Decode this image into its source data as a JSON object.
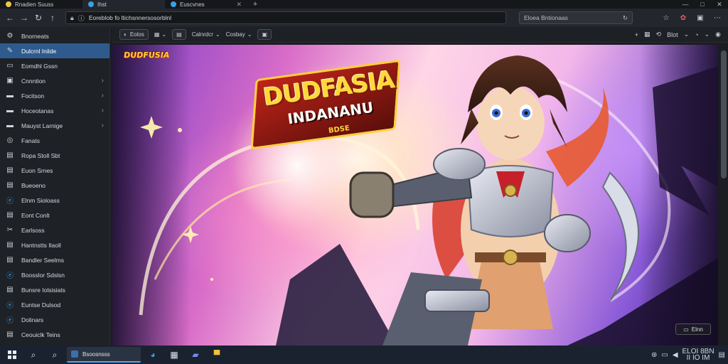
{
  "tabs": [
    {
      "label": "Rnadien Suuss",
      "active": false
    },
    {
      "label": "Ihst",
      "active": true
    },
    {
      "label": "Euscvnes",
      "active": false
    }
  ],
  "window_controls": {
    "minimize": "—",
    "maximize": "□",
    "close": "✕"
  },
  "address": {
    "url": "Eoreblob fo ltichsnnersosorblnl",
    "search_placeholder": "Eloea Bntionaas"
  },
  "sidebar": {
    "items": [
      {
        "label": "Bnorneats",
        "icon": "gear-icon",
        "chevron": false,
        "active": false
      },
      {
        "label": "Dulcrnl Inilde",
        "icon": "pencil-icon",
        "chevron": false,
        "active": true
      },
      {
        "label": "Eomdhl Gssn",
        "icon": "monitor-icon",
        "chevron": false,
        "active": false
      },
      {
        "label": "Cnnntion",
        "icon": "window-icon",
        "chevron": true,
        "active": false
      },
      {
        "label": "Focitson",
        "icon": "folder-icon",
        "chevron": true,
        "active": false
      },
      {
        "label": "Hoceotanas",
        "icon": "folder-icon",
        "chevron": true,
        "active": false
      },
      {
        "label": "Mauyst Larnige",
        "icon": "folder-icon",
        "chevron": true,
        "active": false
      },
      {
        "label": "Fanats",
        "icon": "globe-icon",
        "chevron": false,
        "active": false
      },
      {
        "label": "Ropa Stoll Sbt",
        "icon": "document-icon",
        "chevron": false,
        "active": false
      },
      {
        "label": "Euon Srnes",
        "icon": "document-icon",
        "chevron": false,
        "active": false
      },
      {
        "label": "Bueoeno",
        "icon": "document-icon",
        "chevron": false,
        "active": false
      },
      {
        "label": "Elnm Sioloass",
        "icon": "edge-icon",
        "chevron": false,
        "active": false
      },
      {
        "label": "Eont Conlt",
        "icon": "document-icon",
        "chevron": false,
        "active": false
      },
      {
        "label": "Earlsoss",
        "icon": "tools-icon",
        "chevron": false,
        "active": false
      },
      {
        "label": "Hantnstts Ilaoll",
        "icon": "document-icon",
        "chevron": false,
        "active": false
      },
      {
        "label": "Bandler Seelms",
        "icon": "document-icon",
        "chevron": false,
        "active": false
      },
      {
        "label": "Boosslor Sdslsn",
        "icon": "edge-icon",
        "chevron": false,
        "active": false
      },
      {
        "label": "Bunsre Iolsisiats",
        "icon": "document-icon",
        "chevron": false,
        "active": false
      },
      {
        "label": "Euntse Dulsod",
        "icon": "edge-icon",
        "chevron": false,
        "active": false
      },
      {
        "label": "Dolinars",
        "icon": "edge-icon",
        "chevron": false,
        "active": false
      },
      {
        "label": "Ceouiclk Teins",
        "icon": "document-icon",
        "chevron": false,
        "active": false
      }
    ]
  },
  "content_toolbar": {
    "btn1": "Eolos",
    "btn2": "Calnrdcr",
    "dropdown": "Cosbay",
    "right_label": "Blot"
  },
  "hero": {
    "logo_small": "DUDFUSIA",
    "title_line1": "DUDFASIA",
    "title_line2": "INDANANU",
    "title_tag": "BDSE"
  },
  "hero_overlay_button": "Elnn",
  "taskbar": {
    "app_label": "Bsoosnsss",
    "clock_time": "ELOI 8BN",
    "clock_date": "II IO IM"
  },
  "colors": {
    "accent": "#2f5a8d",
    "edge_blue": "#3aa0e6",
    "taskbar_bg": "#1a2230"
  }
}
